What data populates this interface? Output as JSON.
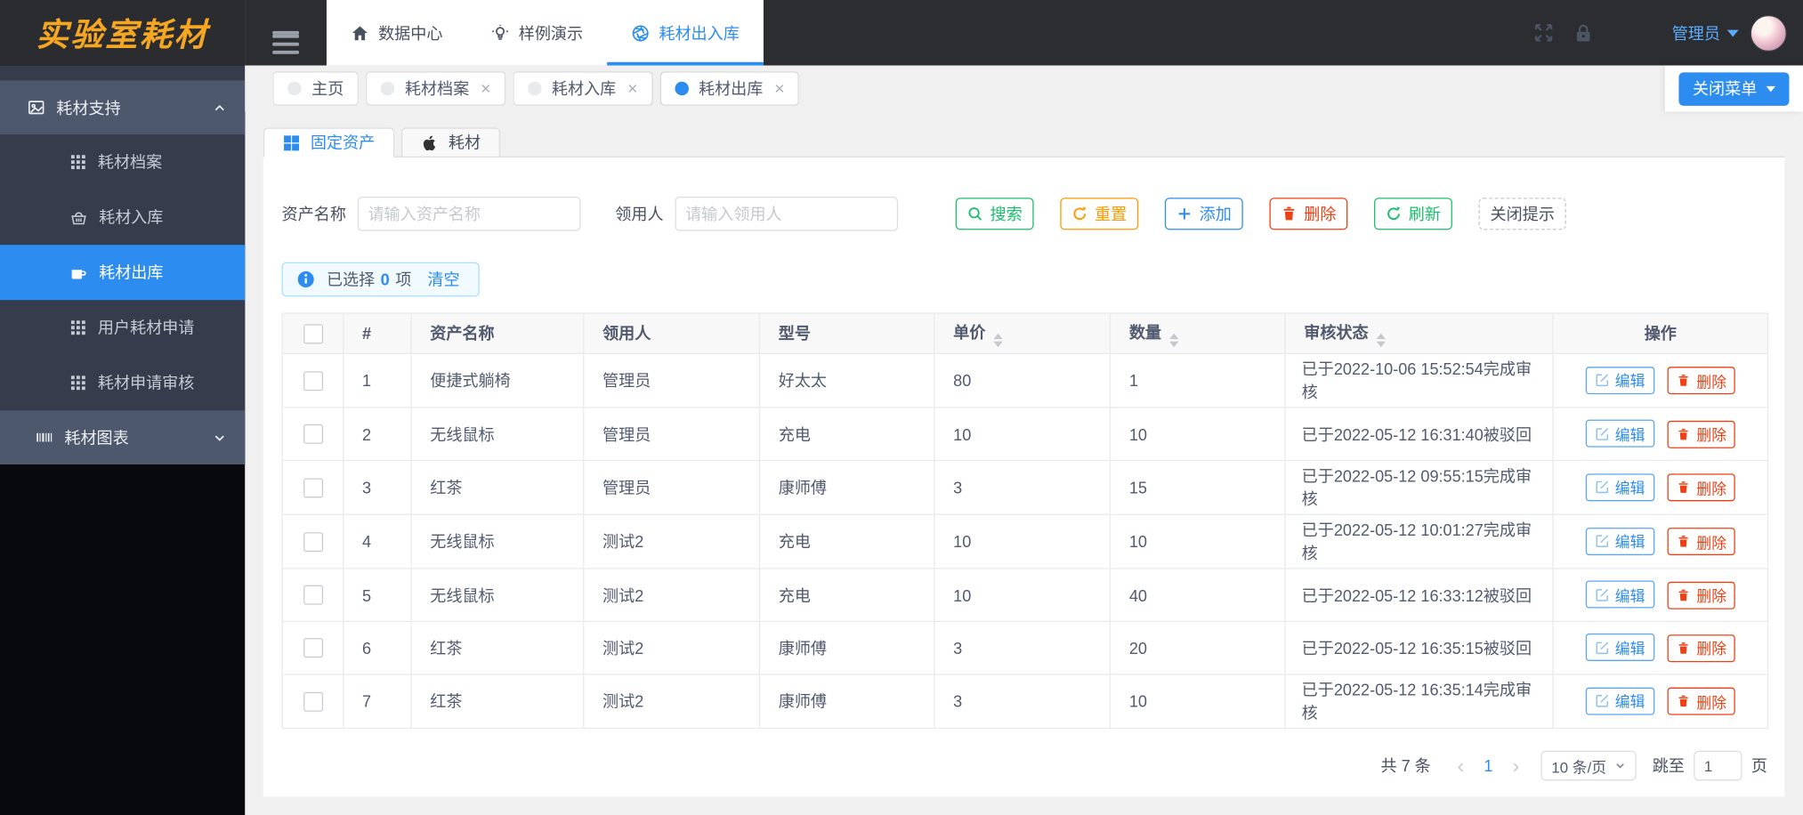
{
  "app": {
    "logo_text": "实验室耗材",
    "user_name": "管理员",
    "close_menu_label": "关闭菜单"
  },
  "topnav": {
    "items": [
      {
        "label": "数据中心",
        "icon": "home-icon"
      },
      {
        "label": "样例演示",
        "icon": "bulb-icon"
      },
      {
        "label": "耗材出入库",
        "icon": "aperture-icon",
        "active": true
      }
    ]
  },
  "sidebar": {
    "section1": {
      "label": "耗材支持"
    },
    "items": [
      {
        "label": "耗材档案"
      },
      {
        "label": "耗材入库"
      },
      {
        "label": "耗材出库",
        "active": true
      },
      {
        "label": "用户耗材申请"
      },
      {
        "label": "耗材申请审核"
      }
    ],
    "section2": {
      "label": "耗材图表"
    }
  },
  "tabbar": {
    "tabs": [
      {
        "label": "主页",
        "closable": false
      },
      {
        "label": "耗材档案",
        "closable": true
      },
      {
        "label": "耗材入库",
        "closable": true
      },
      {
        "label": "耗材出库",
        "closable": true,
        "active": true
      }
    ],
    "close_char": "×"
  },
  "content": {
    "view_tabs": [
      {
        "label": "固定资产",
        "active": true
      },
      {
        "label": "耗材"
      }
    ],
    "filter": {
      "asset_label": "资产名称",
      "asset_placeholder": "请输入资产名称",
      "user_label": "领用人",
      "user_placeholder": "请输入领用人"
    },
    "toolbar": {
      "search": "搜索",
      "reset": "重置",
      "add": "添加",
      "delete": "删除",
      "refresh": "刷新",
      "close_tip": "关闭提示"
    },
    "selection": {
      "prefix": "已选择",
      "count": "0",
      "suffix": "项",
      "clear": "清空"
    },
    "table": {
      "columns": [
        "#",
        "资产名称",
        "领用人",
        "型号",
        "单价",
        "数量",
        "审核状态",
        "操作"
      ],
      "row_actions": {
        "edit": "编辑",
        "delete": "删除"
      },
      "rows": [
        {
          "index": "1",
          "name": "便捷式躺椅",
          "user": "管理员",
          "model": "好太太",
          "price": "80",
          "qty": "1",
          "status": "已于2022-10-06 15:52:54完成审核",
          "status_type": "success"
        },
        {
          "index": "2",
          "name": "无线鼠标",
          "user": "管理员",
          "model": "充电",
          "price": "10",
          "qty": "10",
          "status": "已于2022-05-12 16:31:40被驳回",
          "status_type": "warning"
        },
        {
          "index": "3",
          "name": "红茶",
          "user": "管理员",
          "model": "康师傅",
          "price": "3",
          "qty": "15",
          "status": "已于2022-05-12 09:55:15完成审核",
          "status_type": "success"
        },
        {
          "index": "4",
          "name": "无线鼠标",
          "user": "测试2",
          "model": "充电",
          "price": "10",
          "qty": "10",
          "status": "已于2022-05-12 10:01:27完成审核",
          "status_type": "success"
        },
        {
          "index": "5",
          "name": "无线鼠标",
          "user": "测试2",
          "model": "充电",
          "price": "10",
          "qty": "40",
          "status": "已于2022-05-12 16:33:12被驳回",
          "status_type": "warning"
        },
        {
          "index": "6",
          "name": "红茶",
          "user": "测试2",
          "model": "康师傅",
          "price": "3",
          "qty": "20",
          "status": "已于2022-05-12 16:35:15被驳回",
          "status_type": "warning"
        },
        {
          "index": "7",
          "name": "红茶",
          "user": "测试2",
          "model": "康师傅",
          "price": "3",
          "qty": "10",
          "status": "已于2022-05-12 16:35:14完成审核",
          "status_type": "success"
        }
      ]
    },
    "pagination": {
      "total": "共 7 条",
      "prev": "‹",
      "current_page": "1",
      "next": "›",
      "page_size": "10 条/页",
      "jump_label": "跳至",
      "jump_value": "1",
      "page_unit": "页"
    }
  },
  "colors": {
    "primary": "#2d8cf0",
    "success": "#19be6b",
    "warning": "#ff9900",
    "error": "#ed4014",
    "logo_gold": "#f5a623"
  }
}
